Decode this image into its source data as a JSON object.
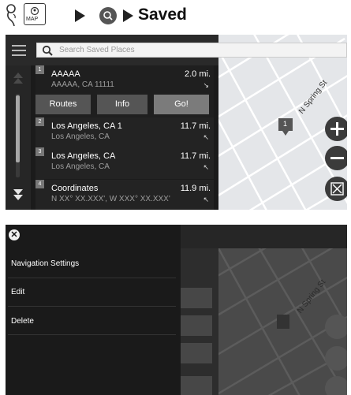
{
  "breadcrumb": {
    "title": "Saved"
  },
  "screen1": {
    "search": {
      "placeholder": "Search Saved Places"
    },
    "places": [
      {
        "index": "1",
        "name": "AAAAA",
        "address": "AAAAA, CA 11111",
        "distance": "2.0 mi."
      },
      {
        "index": "2",
        "name": "Los Angeles, CA 1",
        "address": "Los Angeles, CA",
        "distance": "11.7 mi."
      },
      {
        "index": "3",
        "name": "Los Angeles, CA",
        "address": "Los Angeles, CA",
        "distance": "11.7 mi."
      },
      {
        "index": "4",
        "name": "Coordinates",
        "address": "N XX° XX.XXX', W XXX° XX.XXX'",
        "distance": "11.9 mi."
      }
    ],
    "buttons": {
      "routes": "Routes",
      "info": "Info",
      "go": "Go!"
    },
    "map": {
      "street": "N Spring St",
      "pin_label": "1"
    }
  },
  "screen2": {
    "menu": {
      "items": [
        "Navigation Settings",
        "Edit",
        "Delete"
      ]
    }
  }
}
